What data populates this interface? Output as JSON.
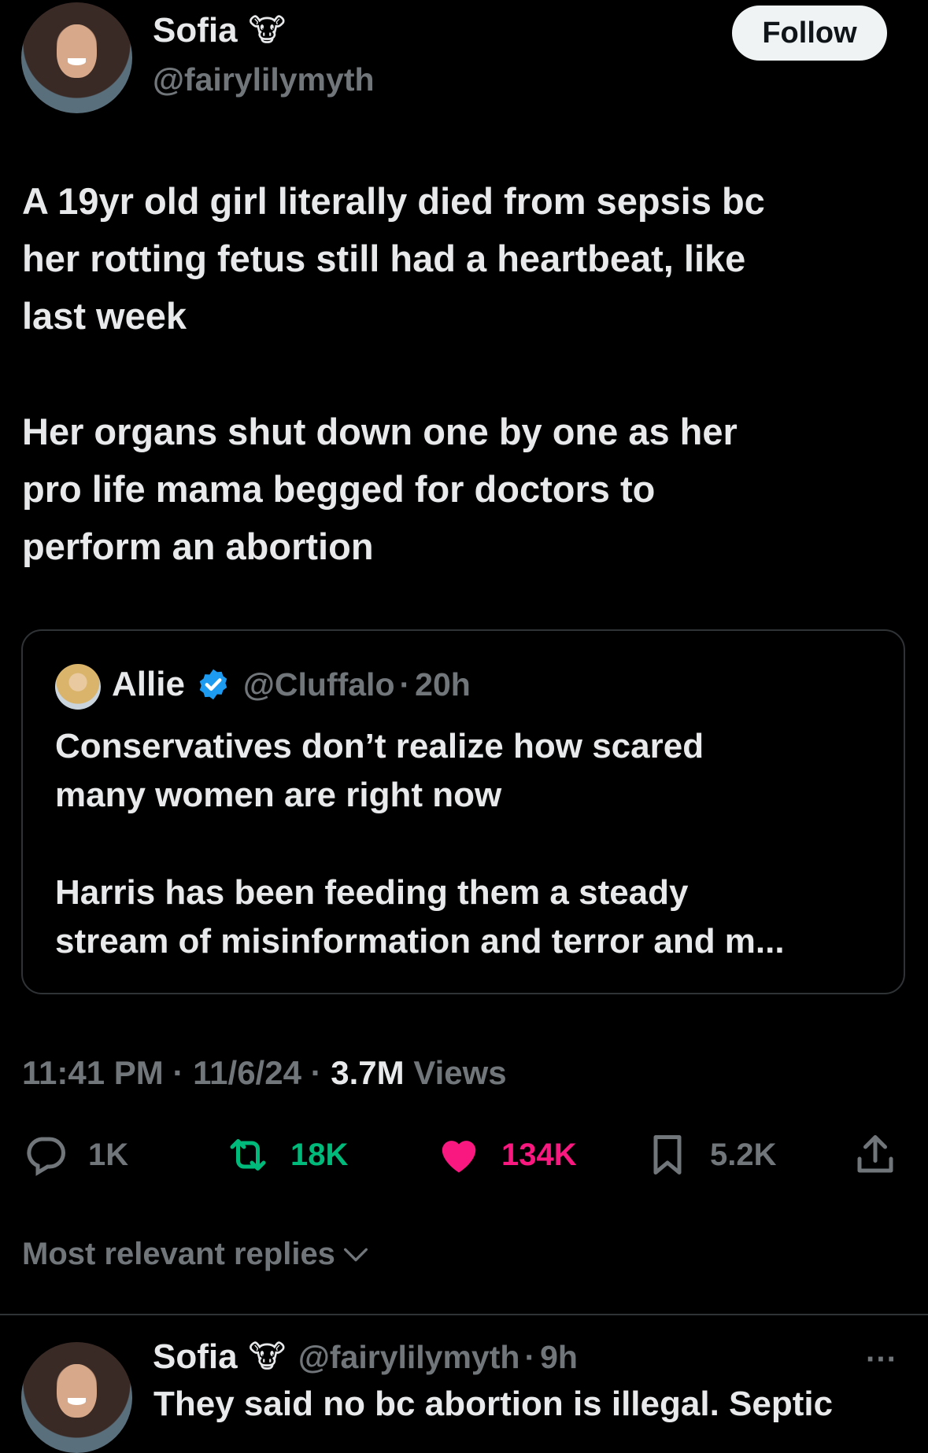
{
  "author": {
    "name": "Sofia",
    "emoji": "🐮",
    "handle": "@fairylilymyth",
    "follow_label": "Follow"
  },
  "tweet": {
    "paragraph1": "A 19yr old girl literally died from sepsis bc\nher rotting fetus still had a heartbeat, like\nlast week",
    "paragraph2": "Her organs shut down one by one as her\npro life mama begged for doctors to\nperform an abortion"
  },
  "quoted": {
    "name": "Allie",
    "handle": "@Cluffalo",
    "separator": "·",
    "time": "20h",
    "paragraph1": "Conservatives don’t realize how scared\nmany women are right now",
    "paragraph2": "Harris has been feeding them a steady\nstream of misinformation and terror and m..."
  },
  "meta": {
    "time": "11:41 PM",
    "sep1": "·",
    "date": "11/6/24",
    "sep2": "·",
    "views_count": "3.7M",
    "views_label": "Views"
  },
  "actions": {
    "replies": "1K",
    "reposts": "18K",
    "likes": "134K",
    "bookmarks": "5.2K"
  },
  "sort_label": "Most relevant replies",
  "reply": {
    "name": "Sofia",
    "emoji": "🐮",
    "handle": "@fairylilymyth",
    "separator": "·",
    "time": "9h",
    "more": "···",
    "text": "They said no bc abortion is illegal. Septic"
  },
  "colors": {
    "background": "#000000",
    "text": "#e7e9ea",
    "muted": "#71767b",
    "repost": "#00ba7c",
    "like": "#f91880",
    "verified": "#1d9bf0",
    "border": "#2f3336"
  }
}
